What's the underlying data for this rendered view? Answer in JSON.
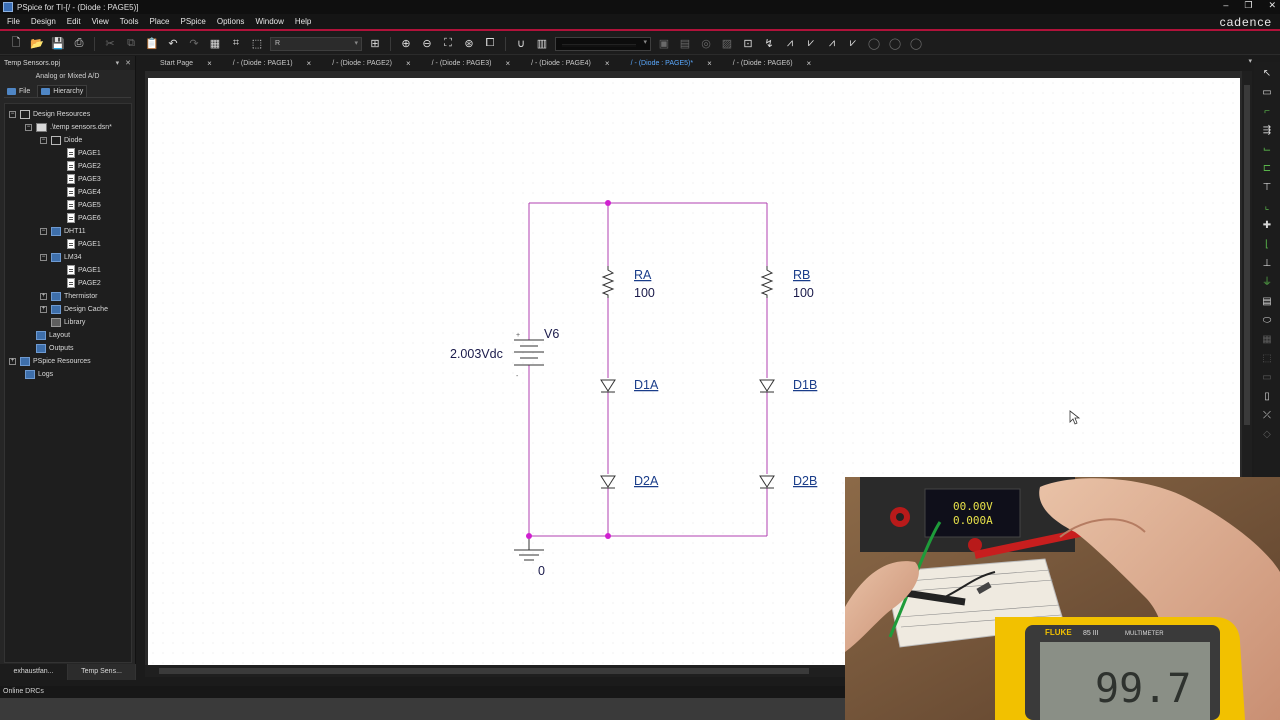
{
  "window": {
    "title": "PSpice for TI-[/ - (Diode : PAGE5)]",
    "brand": "cadence",
    "buttons": [
      "–",
      "❐",
      "✕"
    ]
  },
  "menu": [
    "File",
    "Design",
    "Edit",
    "View",
    "Tools",
    "Place",
    "PSpice",
    "Options",
    "Window",
    "Help"
  ],
  "toolbar": {
    "part_field_value": "R"
  },
  "project_panel": {
    "title": "Temp Sensors.opj",
    "subtitle": "Analog or Mixed A/D",
    "tabs": [
      "File",
      "Hierarchy"
    ],
    "tree": [
      {
        "label": "Design Resources"
      },
      {
        "label": ".\\temp sensors.dsn*"
      },
      {
        "label": "Diode"
      },
      {
        "label": "PAGE1"
      },
      {
        "label": "PAGE2"
      },
      {
        "label": "PAGE3"
      },
      {
        "label": "PAGE4"
      },
      {
        "label": "PAGE5"
      },
      {
        "label": "PAGE6"
      },
      {
        "label": "DHT11"
      },
      {
        "label": "PAGE1"
      },
      {
        "label": "LM34"
      },
      {
        "label": "PAGE1"
      },
      {
        "label": "PAGE2"
      },
      {
        "label": "Thermistor"
      },
      {
        "label": "Design Cache"
      },
      {
        "label": "Library"
      },
      {
        "label": "Layout"
      },
      {
        "label": "Outputs"
      },
      {
        "label": "PSpice Resources"
      },
      {
        "label": "Logs"
      }
    ],
    "bottom_tabs": [
      "exhaustfan...",
      "Temp Sens..."
    ]
  },
  "doc_tabs": [
    {
      "label": "Start Page",
      "active": false
    },
    {
      "label": "/ - (Diode : PAGE1)",
      "active": false
    },
    {
      "label": "/ - (Diode : PAGE2)",
      "active": false
    },
    {
      "label": "/ - (Diode : PAGE3)",
      "active": false
    },
    {
      "label": "/ - (Diode : PAGE4)",
      "active": false
    },
    {
      "label": "/ - (Diode : PAGE5)*",
      "active": true
    },
    {
      "label": "/ - (Diode : PAGE6)",
      "active": false
    }
  ],
  "schematic": {
    "source": {
      "name": "V6",
      "value": "2.003Vdc"
    },
    "ground_label": "0",
    "resistors": [
      {
        "ref": "RA",
        "value": "100"
      },
      {
        "ref": "RB",
        "value": "100"
      }
    ],
    "diodes": [
      "D1A",
      "D2A",
      "D1B",
      "D2B"
    ],
    "wire_color": "#b040b0",
    "node_color": "#d020d0"
  },
  "status": {
    "text": "Online DRCs"
  },
  "webcam": {
    "psu_readout_1": "00.00V",
    "psu_readout_2": "0.000A",
    "meter_brand": "FLUKE",
    "meter_model": "85 III",
    "meter_type": "MULTIMETER",
    "meter_reading": "99.7"
  }
}
